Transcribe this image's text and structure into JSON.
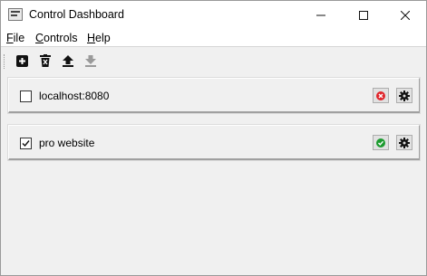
{
  "window": {
    "title": "Control Dashboard",
    "minimize_glyph": "—",
    "maximize_glyph": "☐",
    "close_glyph": "✕"
  },
  "menu": [
    {
      "accel": "F",
      "rest": "ile"
    },
    {
      "accel": "C",
      "rest": "ontrols"
    },
    {
      "accel": "H",
      "rest": "elp"
    }
  ],
  "toolbar": {
    "icons": [
      "add-icon",
      "delete-icon",
      "upload-icon",
      "download-icon"
    ],
    "download_enabled": false
  },
  "items": [
    {
      "label": "localhost:8080",
      "checked": false,
      "status": "error",
      "status_color": "#e0252b"
    },
    {
      "label": "pro website",
      "checked": true,
      "status": "ok",
      "status_color": "#1c9b2f"
    }
  ],
  "colors": {
    "window_bg": "#f0f0f0",
    "titlebar_bg": "#ffffff",
    "error": "#e0252b",
    "ok": "#1c9b2f"
  }
}
